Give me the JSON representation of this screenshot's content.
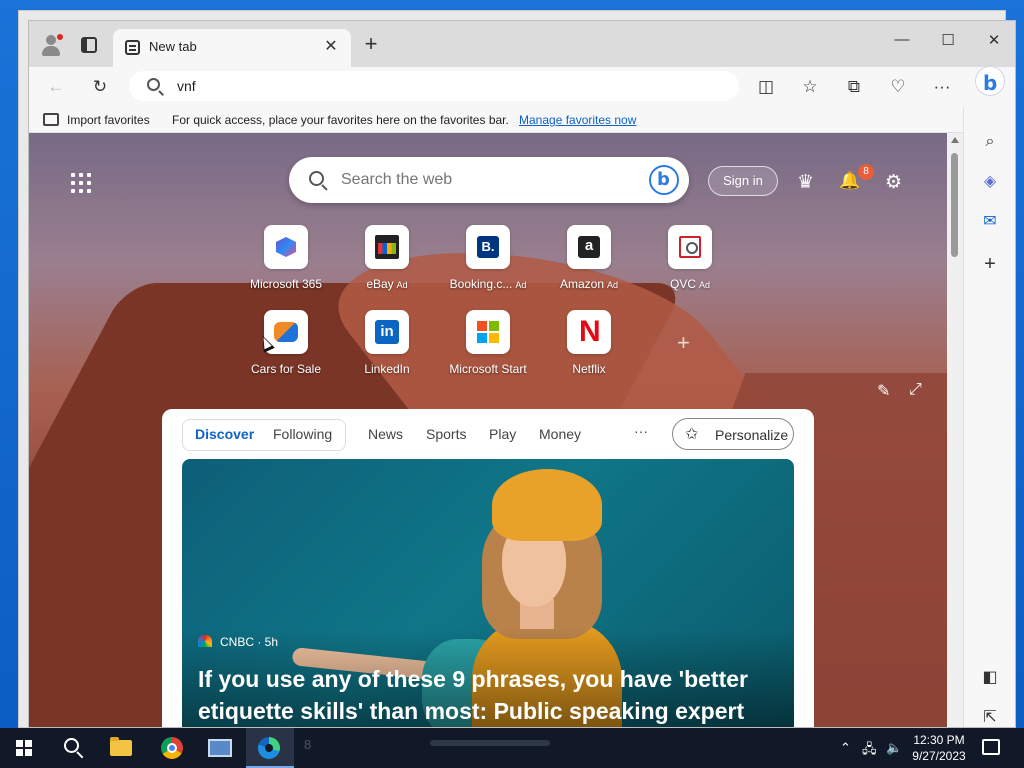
{
  "browser": {
    "tab_title": "New tab",
    "tab_close": "✕",
    "new_tab": "+",
    "window_controls": {
      "minimize": "—",
      "maximize": "☐",
      "close": "✕"
    },
    "address": "vnf",
    "favorites_bar": {
      "import_label": "Import favorites",
      "message": "For quick access, place your favorites here on the favorites bar.",
      "manage_link": "Manage favorites now"
    },
    "toolbar_icons": [
      "back-icon",
      "refresh-icon",
      "split-screen-icon",
      "favorites-icon",
      "collections-icon",
      "browser-essentials-icon",
      "more-icon",
      "bing-chat-icon"
    ],
    "toolbar_glyphs": {
      "back": "←",
      "refresh": "↻",
      "split": "◫",
      "favorites": "☆",
      "collections": "⧉",
      "essentials": "♡",
      "more": "···"
    },
    "sidebar_glyphs": {
      "search": "⌕",
      "copilot": "◈",
      "outlook": "✉",
      "add": "+",
      "hide": "◧",
      "open": "⇱"
    }
  },
  "newtab": {
    "search_placeholder": "Search the web",
    "sign_in": "Sign in",
    "notification_count": "8",
    "icons": {
      "rewards": "♛",
      "bell": "🔔",
      "settings": "⚙",
      "edit_bg": "✎",
      "expand": "⤢",
      "add_site": "+"
    },
    "quick_links": [
      {
        "label": "Microsoft 365",
        "ad": "",
        "icon": "microsoft-365-icon"
      },
      {
        "label": "eBay",
        "ad": "Ad",
        "icon": "ebay-icon"
      },
      {
        "label": "Booking.c...",
        "ad": "Ad",
        "icon": "booking-icon",
        "glyph": "B."
      },
      {
        "label": "Amazon",
        "ad": "Ad",
        "icon": "amazon-icon",
        "glyph": "a"
      },
      {
        "label": "QVC",
        "ad": "Ad",
        "icon": "qvc-icon"
      },
      {
        "label": "Cars for Sale",
        "ad": "",
        "icon": "cars-icon"
      },
      {
        "label": "LinkedIn",
        "ad": "",
        "icon": "linkedin-icon",
        "glyph": "in"
      },
      {
        "label": "Microsoft Start",
        "ad": "",
        "icon": "microsoft-start-icon"
      },
      {
        "label": "Netflix",
        "ad": "",
        "icon": "netflix-icon",
        "glyph": "N"
      }
    ],
    "feed": {
      "tabs": [
        "Discover",
        "Following",
        "News",
        "Sports",
        "Play",
        "Money"
      ],
      "more": "···",
      "personalize": "Personalize",
      "star": "✩",
      "hero": {
        "source": "CNBC · 5h",
        "title": "If you use any of these 9 phrases, you have 'better etiquette skills' than most: Public speaking expert"
      }
    }
  },
  "taskbar": {
    "ghost_label": "8",
    "clock_time": "12:30 PM",
    "clock_date": "9/27/2023",
    "tray": {
      "chevron": "⌃",
      "network": "🖧",
      "volume": "🔈"
    }
  }
}
